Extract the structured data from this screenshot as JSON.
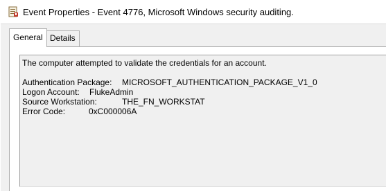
{
  "window": {
    "title": "Event Properties - Event 4776, Microsoft Windows security auditing.",
    "icon": "event-viewer-icon"
  },
  "tabs": [
    {
      "label": "General",
      "selected": true
    },
    {
      "label": "Details",
      "selected": false
    }
  ],
  "description": {
    "summary": "The computer attempted to validate the credentials for an account.",
    "fields": [
      {
        "label": "Authentication Package:",
        "value": "MICROSOFT_AUTHENTICATION_PACKAGE_V1_0"
      },
      {
        "label": "Logon Account:",
        "value": "FlukeAdmin"
      },
      {
        "label": "Source Workstation:",
        "value": "THE_FN_WORKSTAT"
      },
      {
        "label": "Error Code:",
        "value": "0xC000006A"
      }
    ]
  }
}
